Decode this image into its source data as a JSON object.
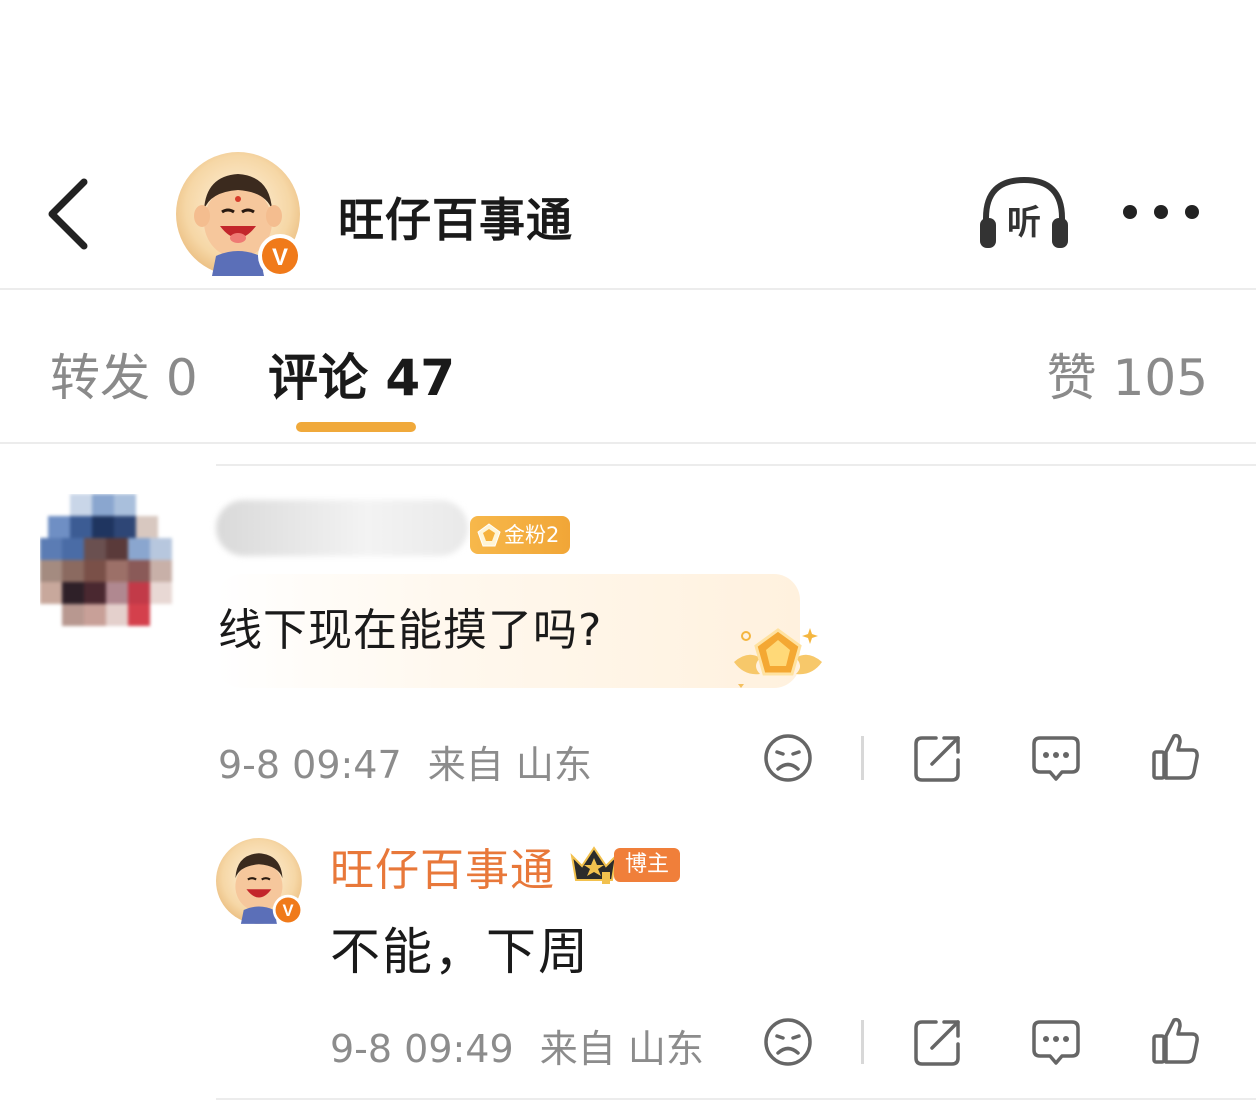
{
  "header": {
    "author_name": "旺仔百事通",
    "listen_label": "听"
  },
  "tabs": [
    {
      "label": "转发 0"
    },
    {
      "label": "评论 47"
    },
    {
      "label": "赞 105"
    }
  ],
  "comment": {
    "fan_badge": "金粉2",
    "text": "线下现在能摸了吗?",
    "time": "9-8 09:47",
    "location": "来自 山东"
  },
  "reply": {
    "author_name": "旺仔百事通",
    "host_badge": "博主",
    "text": "不能，下周",
    "time": "9-8 09:49",
    "location": "来自 山东"
  },
  "colors": {
    "accent": "#f0a93b",
    "reply_name": "#e8783a",
    "verified": "#f07a1a",
    "meta_text": "#8c8c8c"
  },
  "icons": [
    "back-icon",
    "headphones-icon",
    "more-icon",
    "sad-face-icon",
    "share-icon",
    "comment-icon",
    "like-icon"
  ]
}
